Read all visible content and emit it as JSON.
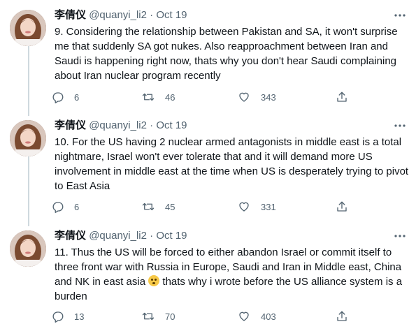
{
  "tweets": [
    {
      "name": "李倩仪",
      "handle": "@quanyi_li2",
      "separator": "·",
      "date": "Oct 19",
      "text": "9. Considering the relationship between Pakistan and SA, it won't surprise me that suddenly SA got nukes. Also reapproachment between Iran and Saudi is happening right now, thats why you don't hear Saudi complaining about Iran nuclear program recently",
      "replies": "6",
      "retweets": "46",
      "likes": "343"
    },
    {
      "name": "李倩仪",
      "handle": "@quanyi_li2",
      "separator": "·",
      "date": "Oct 19",
      "text": "10. For the US having 2 nuclear armed antagonists in middle east is a total nightmare, Israel won't ever tolerate that and it will demand more US involvement in middle east at the time when US is desperately trying to pivot to East Asia",
      "replies": "6",
      "retweets": "45",
      "likes": "331"
    },
    {
      "name": "李倩仪",
      "handle": "@quanyi_li2",
      "separator": "·",
      "date": "Oct 19",
      "text_before_emoji": "11. Thus the US will be forced to either abandon Israel or commit itself to three front war with Russia in Europe, Saudi and Iran in Middle east, China and NK in east asia ",
      "text_after_emoji": " thats why i wrote before the US alliance system is a burden",
      "emoji": "flushed-face",
      "replies": "13",
      "retweets": "70",
      "likes": "403"
    }
  ],
  "icons": {
    "reply": "reply-icon",
    "retweet": "retweet-icon",
    "like": "heart-icon",
    "share": "share-icon",
    "more": "more-icon"
  },
  "colors": {
    "text": "#0f1419",
    "secondary": "#536471",
    "thread_line": "#cfd9de"
  }
}
